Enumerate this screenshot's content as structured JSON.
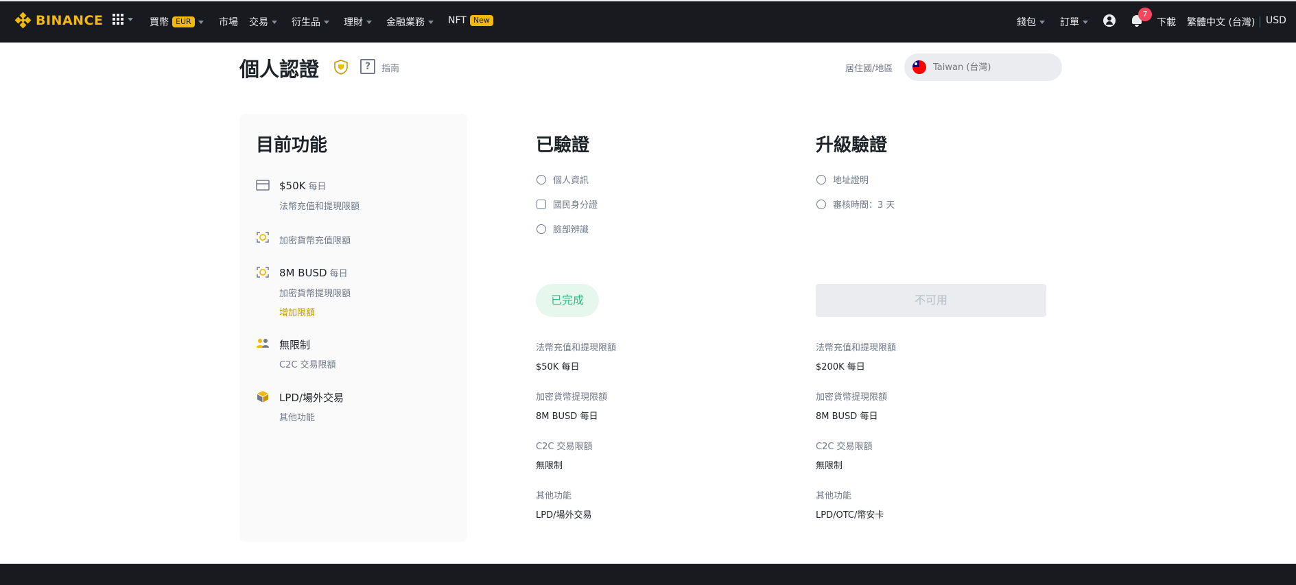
{
  "nav": {
    "brand": "BINANCE",
    "items": [
      {
        "label": "買幣",
        "pill": "EUR",
        "caret": true
      },
      {
        "label": "市場",
        "pill": "",
        "caret": false
      },
      {
        "label": "交易",
        "pill": "",
        "caret": true
      },
      {
        "label": "衍生品",
        "pill": "",
        "caret": true
      },
      {
        "label": "理財",
        "pill": "",
        "caret": true
      },
      {
        "label": "金融業務",
        "pill": "",
        "caret": true
      },
      {
        "label": "NFT",
        "pill": "New",
        "caret": false
      }
    ],
    "right": {
      "wallet": "錢包",
      "orders": "訂單",
      "notification_count": "7",
      "download": "下載",
      "language": "繁體中文 (台灣)",
      "currency": "USD"
    }
  },
  "header": {
    "title": "個人認證",
    "guide": "指南",
    "residence_label": "居住國/地區",
    "residence_value": "Taiwan (台灣)"
  },
  "current": {
    "heading": "目前功能",
    "items": [
      {
        "main": "$50K",
        "period": "每日",
        "sub": "法幣充值和提現限額",
        "icon": "card-icon"
      },
      {
        "main": "",
        "period": "",
        "sub": "加密貨幣充值限額",
        "icon": "crypto-deposit-icon"
      },
      {
        "main": "8M BUSD",
        "period": "每日",
        "sub": "加密貨幣提現限額",
        "link": "增加限額",
        "icon": "crypto-withdraw-icon"
      },
      {
        "main": "無限制",
        "period": "",
        "sub": "C2C 交易限額",
        "icon": "users-icon"
      },
      {
        "main": "LPD/場外交易",
        "period": "",
        "sub": "其他功能",
        "icon": "cube-icon"
      }
    ]
  },
  "verified": {
    "heading": "已驗證",
    "requirements": [
      "個人資訊",
      "國民身分證",
      "臉部辨識"
    ],
    "button": "已完成",
    "limits": [
      {
        "label": "法幣充值和提現限額",
        "value": "$50K 每日"
      },
      {
        "label": "加密貨幣提現限額",
        "value": "8M BUSD 每日"
      },
      {
        "label": "C2C 交易限額",
        "value": "無限制"
      },
      {
        "label": "其他功能",
        "value": "LPD/場外交易"
      }
    ]
  },
  "upgrade": {
    "heading": "升級驗證",
    "requirements": [
      "地址證明",
      "審核時間：3 天"
    ],
    "button": "不可用",
    "limits": [
      {
        "label": "法幣充值和提現限額",
        "value": "$200K 每日"
      },
      {
        "label": "加密貨幣提現限額",
        "value": "8M BUSD 每日"
      },
      {
        "label": "C2C 交易限額",
        "value": "無限制"
      },
      {
        "label": "其他功能",
        "value": "LPD/OTC/幣安卡"
      }
    ]
  },
  "colors": {
    "brand": "#f0b90b",
    "navbar": "#181a20",
    "success": "#2ebd85",
    "link": "#c99400",
    "badge": "#f6465d"
  }
}
